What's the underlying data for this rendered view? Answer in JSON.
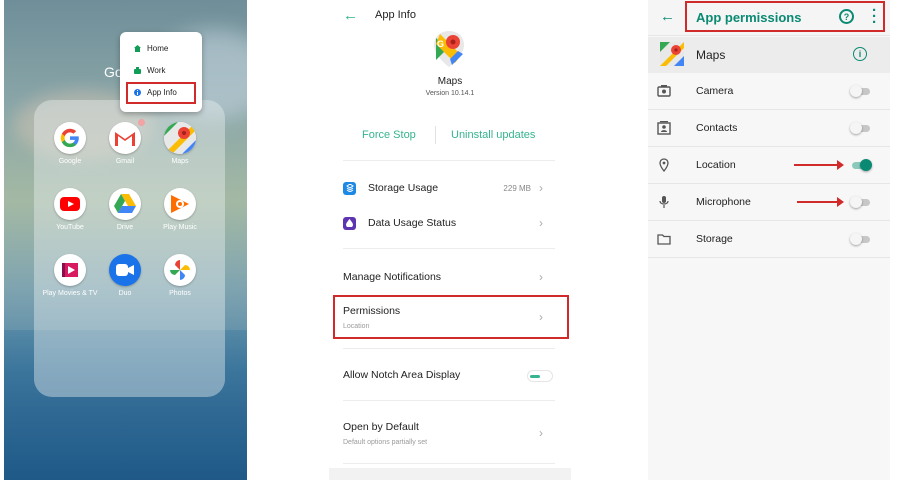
{
  "home": {
    "folder_title": "Go",
    "popup": {
      "items": [
        "Home",
        "Work",
        "App Info"
      ]
    },
    "apps": [
      {
        "label": "Google"
      },
      {
        "label": "Gmail"
      },
      {
        "label": "Maps"
      },
      {
        "label": "YouTube"
      },
      {
        "label": "Drive"
      },
      {
        "label": "Play Music"
      },
      {
        "label": "Play Movies & TV"
      },
      {
        "label": "Duo"
      },
      {
        "label": "Photos"
      }
    ]
  },
  "app_info": {
    "title": "App Info",
    "app_name": "Maps",
    "version": "Version 10.14.1",
    "force_stop": "Force Stop",
    "uninstall_updates": "Uninstall updates",
    "storage_usage": {
      "label": "Storage Usage",
      "value": "229 MB"
    },
    "data_usage": {
      "label": "Data Usage Status"
    },
    "manage_notifications": {
      "label": "Manage Notifications"
    },
    "permissions": {
      "label": "Permissions",
      "sub": "Location"
    },
    "notch": {
      "label": "Allow Notch Area Display",
      "enabled": true
    },
    "open_default": {
      "label": "Open by Default",
      "sub": "Default options partially set"
    }
  },
  "permissions": {
    "title": "App permissions",
    "app_name": "Maps",
    "items": [
      {
        "label": "Camera",
        "icon": "camera-icon",
        "enabled": false
      },
      {
        "label": "Contacts",
        "icon": "contacts-icon",
        "enabled": false
      },
      {
        "label": "Location",
        "icon": "location-icon",
        "enabled": true
      },
      {
        "label": "Microphone",
        "icon": "microphone-icon",
        "enabled": false
      },
      {
        "label": "Storage",
        "icon": "folder-icon",
        "enabled": false
      }
    ]
  },
  "colors": {
    "accent": "#0a8a73",
    "highlight": "#d12a2a",
    "oppo_green": "#35b48f"
  }
}
